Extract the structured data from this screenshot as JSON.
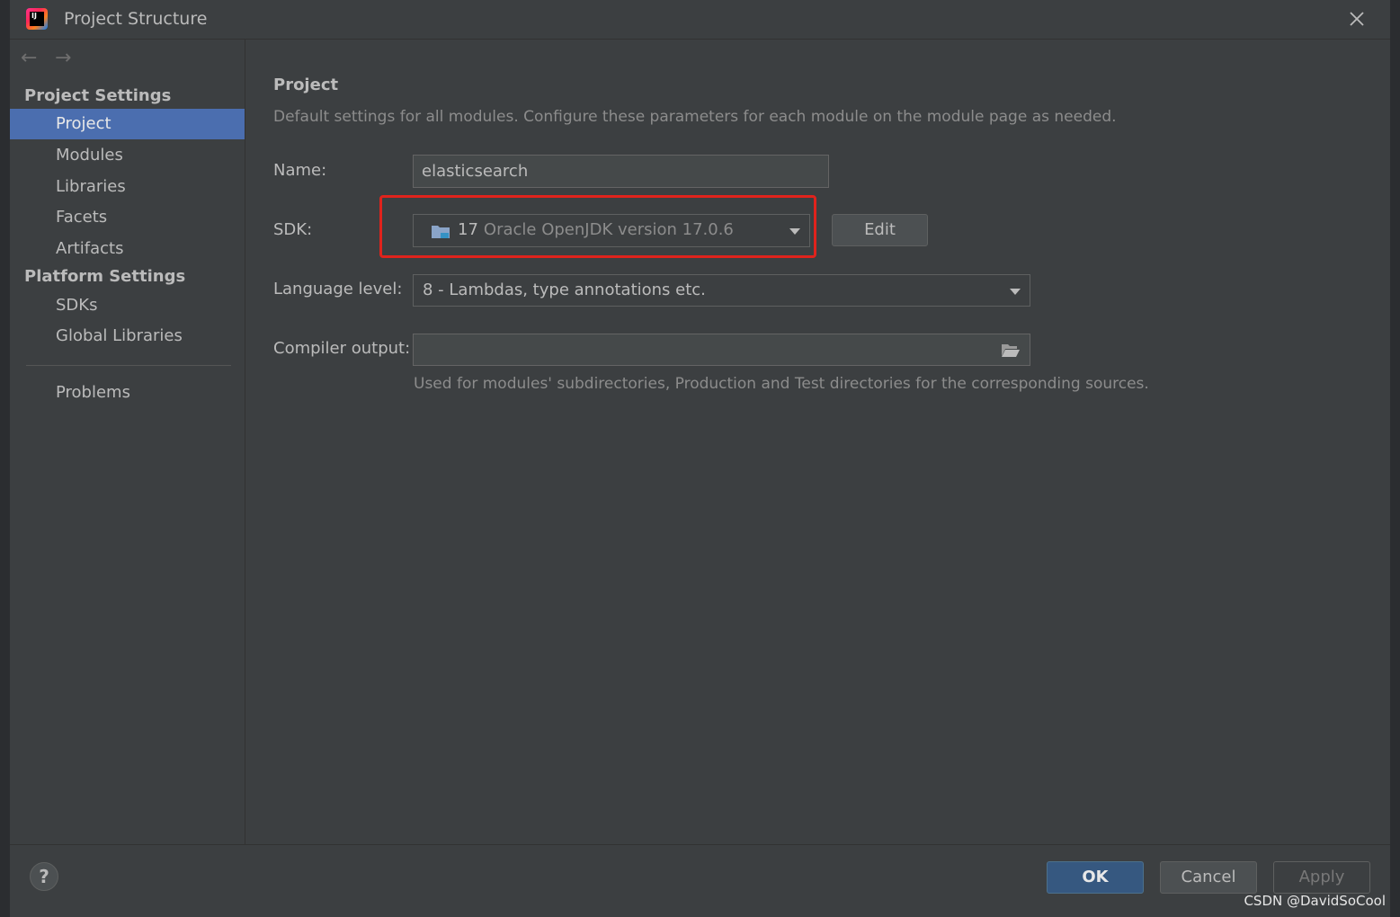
{
  "window": {
    "title": "Project Structure"
  },
  "sidebar": {
    "nav": {
      "back": "←",
      "forward": "→"
    },
    "sections": [
      {
        "heading": "Project Settings",
        "items": [
          "Project",
          "Modules",
          "Libraries",
          "Facets",
          "Artifacts"
        ]
      },
      {
        "heading": "Platform Settings",
        "items": [
          "SDKs",
          "Global Libraries"
        ]
      }
    ],
    "problems": "Problems",
    "selected": "Project"
  },
  "main": {
    "title": "Project",
    "description": "Default settings for all modules. Configure these parameters for each module on the module page as needed.",
    "name": {
      "label": "Name:",
      "value": "elasticsearch"
    },
    "sdk": {
      "label": "SDK:",
      "version": "17",
      "detail": "Oracle OpenJDK version 17.0.6",
      "edit_label": "Edit"
    },
    "language_level": {
      "label": "Language level:",
      "value": "8 - Lambdas, type annotations etc."
    },
    "compiler_output": {
      "label": "Compiler output:",
      "value": "",
      "hint": "Used for modules' subdirectories, Production and Test directories for the corresponding sources."
    }
  },
  "footer": {
    "help": "?",
    "ok": "OK",
    "cancel": "Cancel",
    "apply": "Apply"
  },
  "watermark": "CSDN @DavidSoCool",
  "colors": {
    "background": "#3c3f41",
    "selection": "#4b6eaf",
    "ok_button": "#365880",
    "highlight": "#e0231c"
  }
}
